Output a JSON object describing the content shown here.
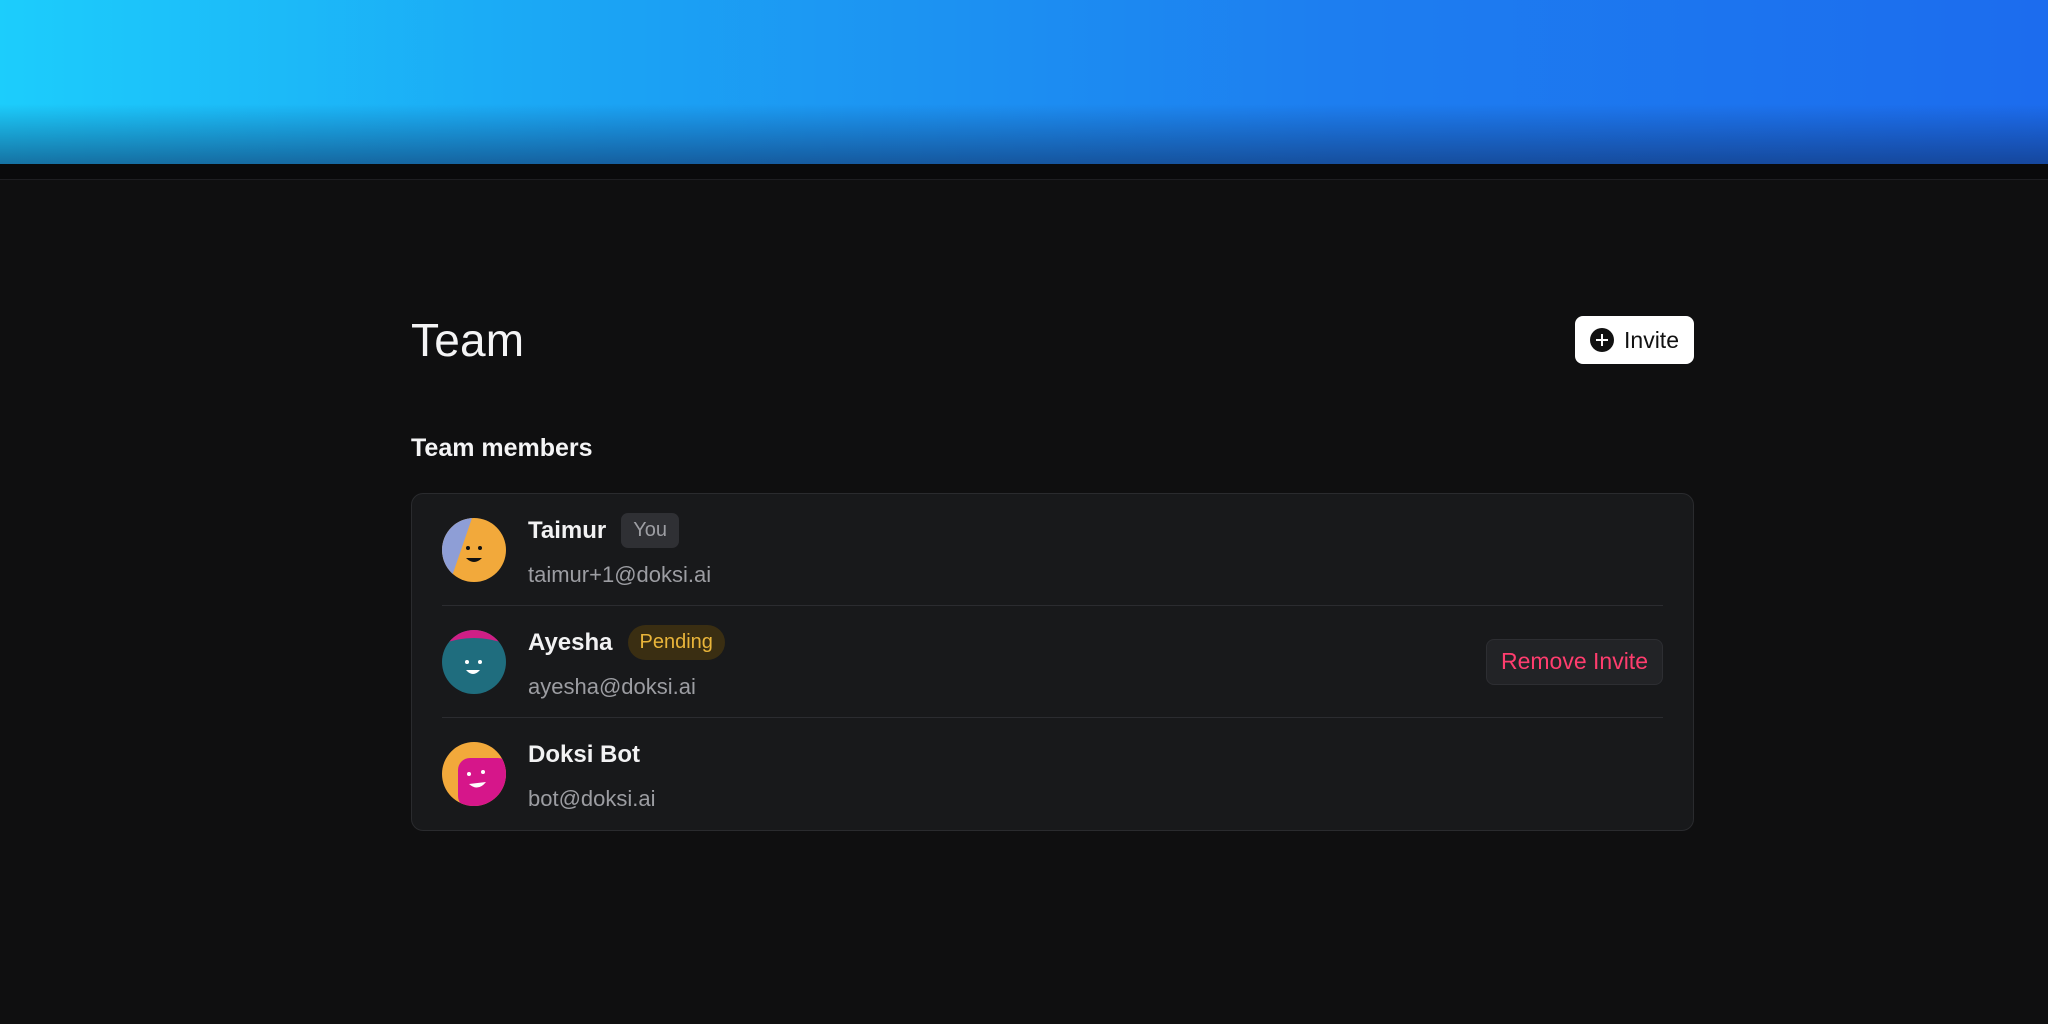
{
  "page": {
    "title": "Team",
    "invite_label": "Invite",
    "section_title": "Team members"
  },
  "members": [
    {
      "name": "Taimur",
      "badge": "You",
      "email": "taimur+1@doksi.ai",
      "avatar_colors": [
        "#f2a93b",
        "#8e9ed6"
      ]
    },
    {
      "name": "Ayesha",
      "badge": "Pending",
      "email": "ayesha@doksi.ai",
      "action_label": "Remove Invite",
      "avatar_colors": [
        "#1f6d7e",
        "#cf1f86"
      ]
    },
    {
      "name": "Doksi Bot",
      "email": "bot@doksi.ai",
      "avatar_colors": [
        "#f2a93b",
        "#d6168a"
      ]
    }
  ],
  "colors": {
    "accent_danger": "#ff3d6e",
    "pending": "#e9b53a",
    "banner_start": "#1ccdfc",
    "banner_end": "#1c6cee"
  }
}
